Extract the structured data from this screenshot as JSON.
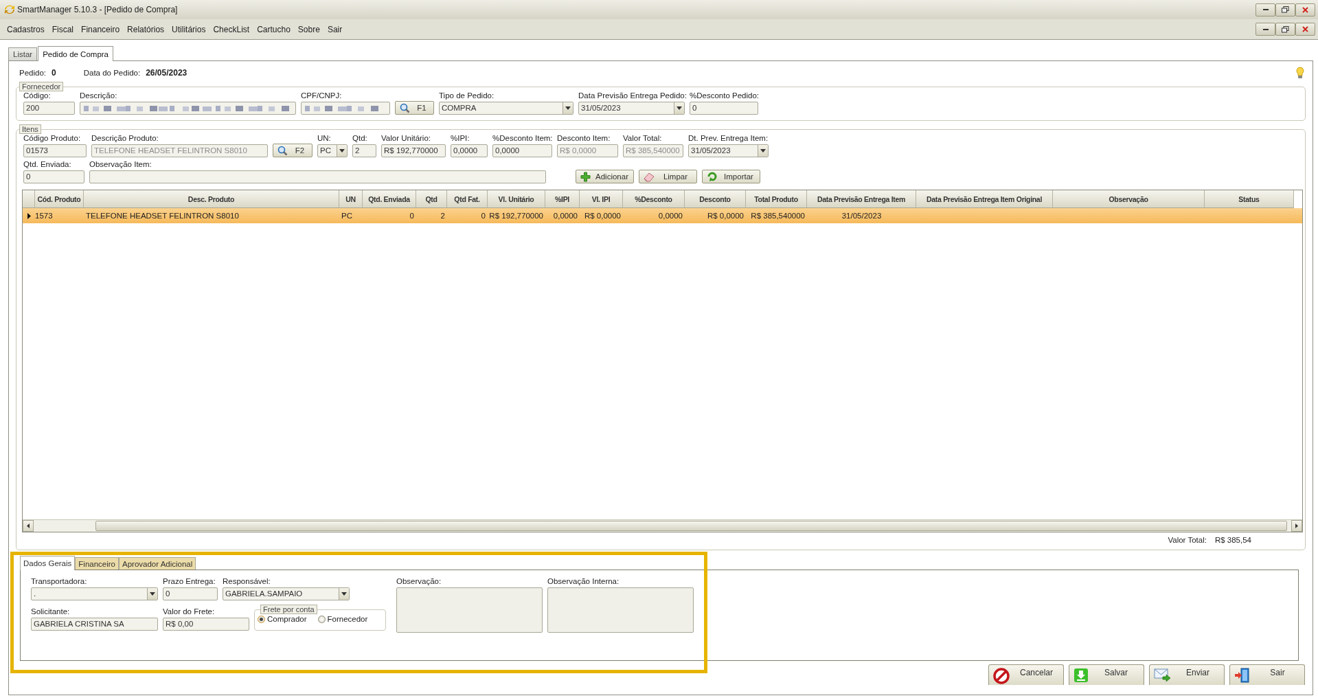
{
  "window": {
    "title": "SmartManager 5.10.3 - [Pedido de Compra]"
  },
  "menu": [
    "Cadastros",
    "Fiscal",
    "Financeiro",
    "Relatórios",
    "Utilitários",
    "CheckList",
    "Cartucho",
    "Sobre",
    "Sair"
  ],
  "tabs": [
    {
      "label": "Listar",
      "selected": false
    },
    {
      "label": "Pedido de Compra",
      "selected": true
    }
  ],
  "order": {
    "number_label": "Pedido:",
    "number": "0",
    "date_label": "Data do Pedido:",
    "date": "26/05/2023"
  },
  "supplier": {
    "title": "Fornecedor",
    "fields": [
      {
        "kind": "text",
        "label": "Código:",
        "value": "200"
      },
      {
        "kind": "redacted",
        "label": "Descrição:"
      },
      {
        "kind": "redacted",
        "label": "CPF/CNPJ:"
      },
      {
        "kind": "search",
        "text": "F1"
      },
      {
        "kind": "combo",
        "label": "Tipo de Pedido:",
        "value": "COMPRA"
      },
      {
        "kind": "combo",
        "label": "Data Previsão Entrega Pedido:",
        "value": "31/05/2023"
      },
      {
        "kind": "text",
        "label": "%Desconto Pedido:",
        "value": "0"
      }
    ]
  },
  "items": {
    "title": "Itens",
    "rows": [
      [
        {
          "kind": "text",
          "label": "Código Produto:",
          "value": "01573",
          "disabled": false
        },
        {
          "kind": "text",
          "label": "Descrição Produto:",
          "value": "TELEFONE HEADSET FELINTRON S8010",
          "disabled": true
        },
        {
          "kind": "search",
          "text": "F2"
        },
        {
          "kind": "combo",
          "label": "UN:",
          "value": "PC",
          "disabled": false
        },
        {
          "kind": "text",
          "label": "Qtd:",
          "value": "2",
          "disabled": false
        },
        {
          "kind": "text",
          "label": "Valor Unitário:",
          "value": "R$ 192,770000",
          "disabled": false
        },
        {
          "kind": "text",
          "label": "%IPI:",
          "value": "0,0000",
          "disabled": false
        },
        {
          "kind": "text",
          "label": "%Desconto Item:",
          "value": "0,0000",
          "disabled": false
        },
        {
          "kind": "text",
          "label": "Desconto Item:",
          "value": "R$ 0,0000",
          "disabled": true
        },
        {
          "kind": "text",
          "label": "Valor Total:",
          "value": "R$ 385,540000",
          "disabled": true
        },
        {
          "kind": "combo",
          "label": "Dt. Prev. Entrega Item:",
          "value": "31/05/2023",
          "disabled": false
        }
      ],
      [
        {
          "kind": "text",
          "label": "Qtd. Enviada:",
          "value": "0"
        },
        {
          "kind": "text",
          "label": "Observação Item:"
        }
      ]
    ],
    "buttons": [
      {
        "kind": "add",
        "text": "Adicionar"
      },
      {
        "kind": "clear",
        "text": "Limpar"
      },
      {
        "kind": "import",
        "text": "Importar"
      }
    ]
  },
  "grid": {
    "columns": [
      "Cód. Produto",
      "Desc. Produto",
      "UN",
      "Qtd. Enviada",
      "Qtd",
      "Qtd Fat.",
      "Vl. Unitário",
      "%IPI",
      "Vl. IPI",
      "%Desconto",
      "Desconto",
      "Total Produto",
      "Data Previsão Entrega Item",
      "Data Previsão Entrega Item Original",
      "Observação",
      "Status"
    ],
    "rows": [
      {
        "selected": true,
        "cells": [
          "1573",
          "TELEFONE HEADSET FELINTRON S8010",
          "PC",
          "0",
          "2",
          "0",
          "R$ 192,770000",
          "0,0000",
          "R$ 0,0000",
          "0,0000",
          "R$ 0,0000",
          "R$ 385,540000",
          "31/05/2023"
        ]
      }
    ]
  },
  "total": {
    "label": "Valor Total:",
    "value": "R$ 385,54"
  },
  "details": {
    "highlighted": true,
    "tabs": [
      {
        "label": "Dados Gerais",
        "selected": true
      },
      {
        "label": "Financeiro",
        "selected": false
      },
      {
        "label": "Aprovador Adicional",
        "selected": false
      }
    ],
    "fields": [
      {
        "kind": "combo",
        "label": "Transportadora:",
        "value": "."
      },
      {
        "kind": "text",
        "label": "Prazo Entrega:",
        "value": "0"
      },
      {
        "kind": "combo",
        "label": "Responsável:",
        "value": "GABRIELA.SAMPAIO"
      },
      {
        "kind": "textarea",
        "label": "Observação:"
      },
      {
        "kind": "textarea",
        "label": "Observação Interna:"
      },
      {
        "kind": "text",
        "label": "Solicitante:",
        "value": "GABRIELA CRISTINA SA"
      },
      {
        "kind": "text",
        "label": "Valor do Frete:",
        "value": "R$ 0,00"
      }
    ],
    "freight": {
      "title": "Frete por conta",
      "options": [
        {
          "label": "Comprador",
          "selected": true
        },
        {
          "label": "Fornecedor",
          "selected": false
        }
      ]
    }
  },
  "actions": [
    {
      "kind": "cancel",
      "label": "Cancelar"
    },
    {
      "kind": "save",
      "label": "Salvar"
    },
    {
      "kind": "send",
      "label": "Enviar"
    },
    {
      "kind": "exit",
      "label": "Sair"
    }
  ]
}
